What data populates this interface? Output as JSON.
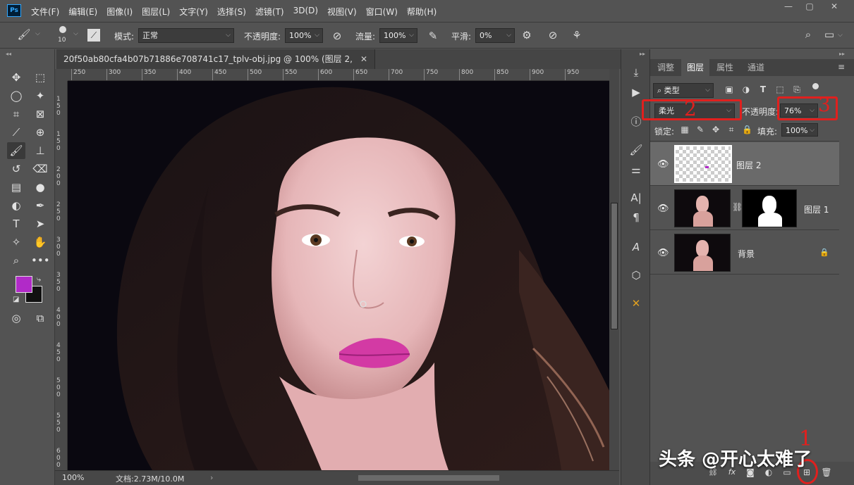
{
  "app": {
    "logo": "Ps"
  },
  "menu": [
    "文件(F)",
    "编辑(E)",
    "图像(I)",
    "图层(L)",
    "文字(Y)",
    "选择(S)",
    "滤镜(T)",
    "3D(D)",
    "视图(V)",
    "窗口(W)",
    "帮助(H)"
  ],
  "options": {
    "brush_size": "10",
    "mode_label": "模式:",
    "mode_value": "正常",
    "opacity_label": "不透明度:",
    "opacity_value": "100%",
    "flow_label": "流量:",
    "flow_value": "100%",
    "smooth_label": "平滑:",
    "smooth_value": "0%"
  },
  "document": {
    "tab_title": "20f50ab80cfa4b07b71886e708741c17_tplv-obj.jpg @ 100% (图层 2, RGB/8) *"
  },
  "ruler": {
    "h_ticks": [
      "250",
      "300",
      "350",
      "400",
      "450",
      "500",
      "550",
      "600",
      "650",
      "700",
      "750",
      "800",
      "850",
      "900",
      "950"
    ],
    "v_ticks": [
      "1",
      "5",
      "0",
      "1",
      "5",
      "0",
      "2",
      "0",
      "0",
      "2",
      "5",
      "0",
      "3",
      "0",
      "0",
      "3",
      "5",
      "0",
      "4",
      "0",
      "0",
      "4",
      "5",
      "0",
      "5",
      "0",
      "0",
      "5",
      "5",
      "0",
      "6",
      "0",
      "0"
    ]
  },
  "status": {
    "zoom": "100%",
    "doc_info": "文档:2.73M/10.0M"
  },
  "colors": {
    "foreground": "#b12ac8",
    "background": "#111111",
    "accent_red": "#e0201e",
    "panel_bg": "#535353"
  },
  "layers_panel": {
    "tabs": [
      "调整",
      "图层",
      "属性",
      "通道"
    ],
    "filter_label": "类型",
    "blend_mode": "柔光",
    "opacity_label": "不透明度:",
    "opacity_value": "76%",
    "lock_label": "锁定:",
    "fill_label": "填充:",
    "fill_value": "100%",
    "layers": [
      {
        "name": "图层 2",
        "selected": true,
        "visible": true
      },
      {
        "name": "图层 1",
        "selected": false,
        "visible": true,
        "has_mask": true
      },
      {
        "name": "背景",
        "selected": false,
        "visible": true,
        "locked": true
      }
    ]
  },
  "annotations": {
    "n1": "1",
    "n2": "2",
    "n3": "3"
  },
  "watermark": "头条 @开心太难了"
}
